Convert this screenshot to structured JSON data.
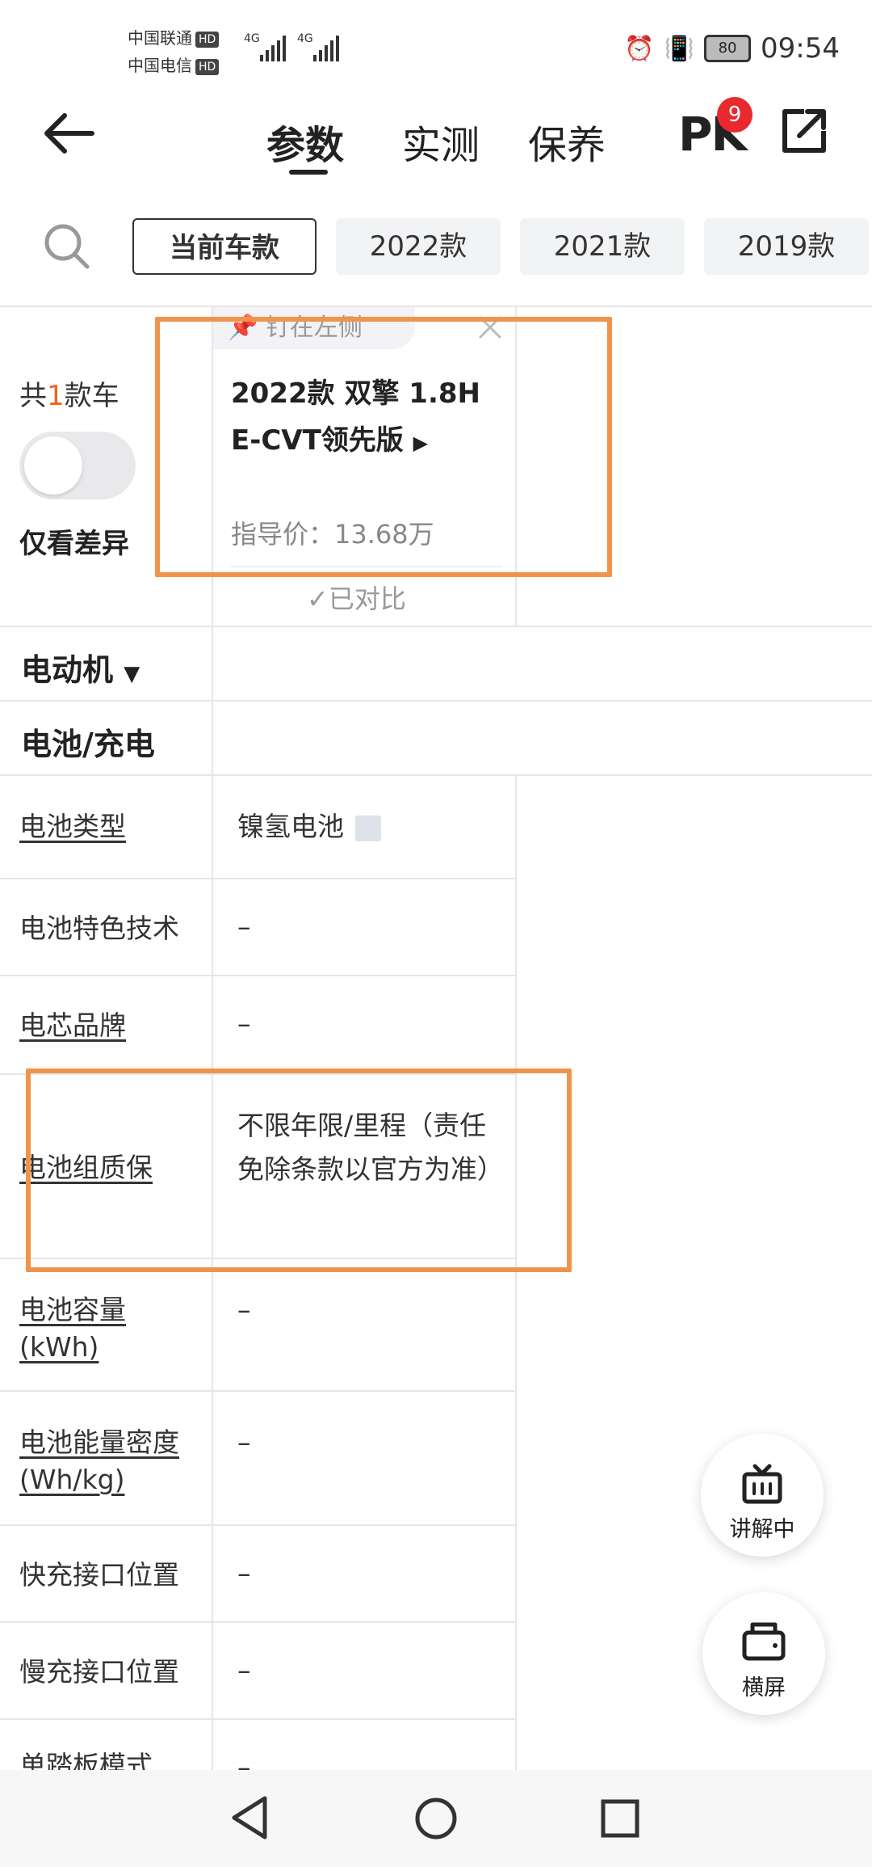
{
  "status_bar": {
    "carrier1": "中国联通",
    "carrier2": "中国电信",
    "hd": "HD",
    "net": "4G",
    "battery": "80",
    "time": "09:54"
  },
  "header": {
    "tabs": [
      {
        "label": "参数",
        "active": true
      },
      {
        "label": "实测",
        "active": false
      },
      {
        "label": "保养",
        "active": false
      }
    ],
    "pk_label": "PK",
    "pk_badge": "9"
  },
  "filters": {
    "chips": [
      {
        "label": "当前车款",
        "active": true
      },
      {
        "label": "2022款",
        "active": false
      },
      {
        "label": "2021款",
        "active": false
      },
      {
        "label": "2019款",
        "active": false
      }
    ]
  },
  "compare": {
    "count_prefix": "共",
    "count_num": "1",
    "count_suffix": "款车",
    "diff_toggle_label": "仅看差异",
    "diff_toggle_on": false
  },
  "car": {
    "pin_label": "钉在左侧",
    "name_line1": "2022款 双擎 1.8H",
    "name_line2": "E-CVT领先版",
    "price": "指导价：13.68万",
    "compared_label": "已对比"
  },
  "sections": {
    "motor": "电动机",
    "battery": "电池/充电"
  },
  "rows": [
    {
      "label": "电池类型",
      "value": "镍氢电池"
    },
    {
      "label": "电池特色技术",
      "value": "–"
    },
    {
      "label": "电芯品牌",
      "value": "–"
    },
    {
      "label": "电池组质保",
      "value": "不限年限/里程（责任免除条款以官方为准）"
    },
    {
      "label": "电池容量(kWh)",
      "value": "–"
    },
    {
      "label": "电池能量密度(Wh/kg)",
      "value": "–"
    },
    {
      "label": "快充接口位置",
      "value": "–"
    },
    {
      "label": "慢充接口位置",
      "value": "–"
    },
    {
      "label": "单踏板模式",
      "value": "–"
    }
  ],
  "fabs": {
    "explain": "讲解中",
    "landscape": "横屏"
  }
}
